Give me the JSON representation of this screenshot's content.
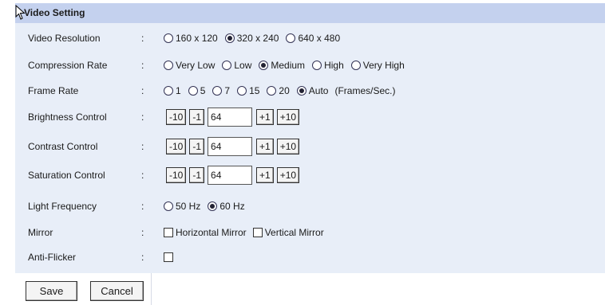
{
  "section_title": "Video Setting",
  "colon": ":",
  "video_resolution": {
    "label": "Video Resolution",
    "options": [
      "160 x 120",
      "320 x 240",
      "640 x 480"
    ],
    "selected": "320 x 240"
  },
  "compression_rate": {
    "label": "Compression Rate",
    "options": [
      "Very Low",
      "Low",
      "Medium",
      "High",
      "Very High"
    ],
    "selected": "Medium"
  },
  "frame_rate": {
    "label": "Frame Rate",
    "options": [
      "1",
      "5",
      "7",
      "15",
      "20",
      "Auto"
    ],
    "selected": "Auto",
    "unit": "(Frames/Sec.)"
  },
  "brightness": {
    "label": "Brightness Control",
    "value": "64"
  },
  "contrast": {
    "label": "Contrast Control",
    "value": "64"
  },
  "saturation": {
    "label": "Saturation Control",
    "value": "64"
  },
  "step_buttons": {
    "minus10": "-10",
    "minus1": "-1",
    "plus1": "+1",
    "plus10": "+10"
  },
  "light_frequency": {
    "label": "Light Frequency",
    "options": [
      "50 Hz",
      "60 Hz"
    ],
    "selected": "60 Hz"
  },
  "mirror": {
    "label": "Mirror",
    "horizontal_label": "Horizontal Mirror",
    "horizontal_checked": false,
    "vertical_label": "Vertical Mirror",
    "vertical_checked": false
  },
  "anti_flicker": {
    "label": "Anti-Flicker",
    "checked": false
  },
  "buttons": {
    "save": "Save",
    "cancel": "Cancel"
  }
}
